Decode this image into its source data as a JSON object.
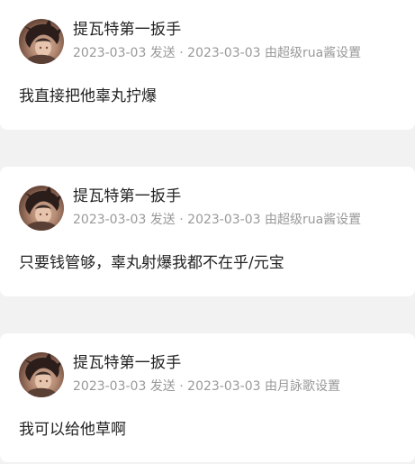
{
  "comments": [
    {
      "author": "提瓦特第一扳手",
      "meta": "2023-03-03 发送 · 2023-03-03 由超级rua酱设置",
      "text": "我直接把他辜丸拧爆",
      "avatar_icon": "user-avatar"
    },
    {
      "author": "提瓦特第一扳手",
      "meta": "2023-03-03 发送 · 2023-03-03 由超级rua酱设置",
      "text": "只要钱管够，辜丸射爆我都不在乎/元宝",
      "avatar_icon": "user-avatar"
    },
    {
      "author": "提瓦特第一扳手",
      "meta": "2023-03-03 发送 · 2023-03-03 由月詠歌设置",
      "text": "我可以给他草啊",
      "avatar_icon": "user-avatar"
    }
  ],
  "colors": {
    "background": "#f2f2f2",
    "card": "#ffffff",
    "name_text": "#222222",
    "meta_text": "#999999"
  }
}
